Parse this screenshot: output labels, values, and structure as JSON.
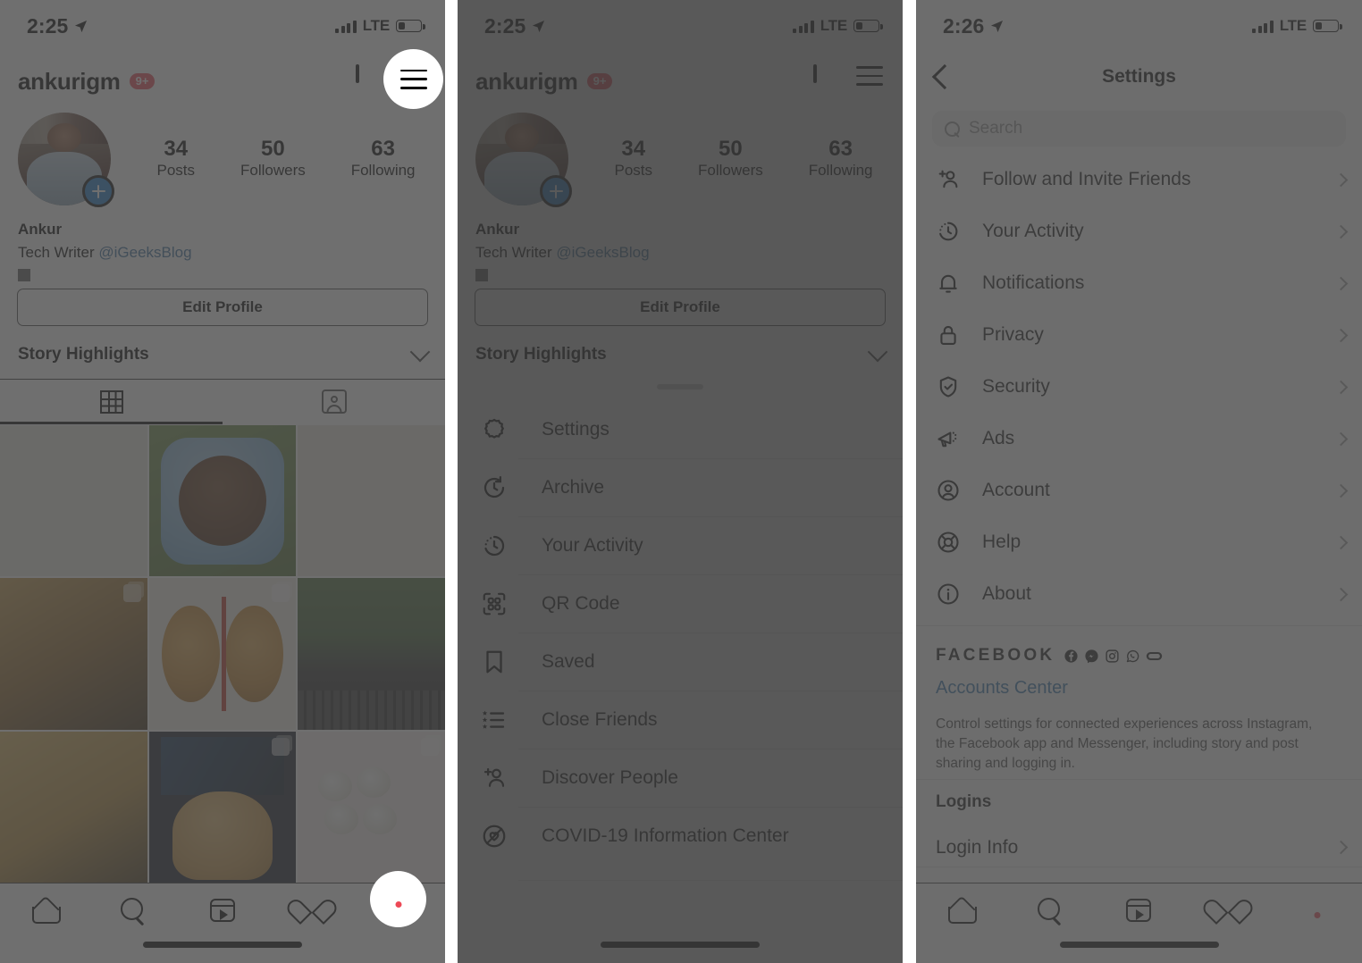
{
  "panel1": {
    "status": {
      "time": "2:25",
      "network": "LTE"
    },
    "profile": {
      "username": "ankurigm",
      "badge": "9+",
      "stats": [
        {
          "number": "34",
          "label": "Posts"
        },
        {
          "number": "50",
          "label": "Followers"
        },
        {
          "number": "63",
          "label": "Following"
        }
      ],
      "display_name": "Ankur",
      "bio_prefix": "Tech Writer ",
      "bio_mention": "@iGeeksBlog",
      "edit_profile_label": "Edit Profile",
      "story_highlights_label": "Story Highlights"
    },
    "icons": {
      "add": "plus-square-icon",
      "menu": "hamburger-menu-icon",
      "grid_tab": "grid-icon",
      "tagged_tab": "tagged-photos-icon",
      "chevron": "chevron-down-icon"
    },
    "tabbar": [
      "home-icon",
      "search-icon",
      "reels-icon",
      "heart-icon",
      "profile-avatar"
    ]
  },
  "panel2": {
    "status": {
      "time": "2:25",
      "network": "LTE"
    },
    "profile": {
      "username": "ankurigm",
      "badge": "9+",
      "stats": [
        {
          "number": "34",
          "label": "Posts"
        },
        {
          "number": "50",
          "label": "Followers"
        },
        {
          "number": "63",
          "label": "Following"
        }
      ],
      "display_name": "Ankur",
      "bio_prefix": "Tech Writer ",
      "bio_mention": "@iGeeksBlog",
      "edit_profile_label": "Edit Profile",
      "story_highlights_label": "Story Highlights"
    },
    "sheet": {
      "items": [
        {
          "label": "Settings",
          "icon": "gear-icon",
          "highlighted": true
        },
        {
          "label": "Archive",
          "icon": "archive-clock-icon",
          "highlighted": false
        },
        {
          "label": "Your Activity",
          "icon": "activity-clock-icon",
          "highlighted": false
        },
        {
          "label": "QR Code",
          "icon": "qr-code-icon",
          "highlighted": false
        },
        {
          "label": "Saved",
          "icon": "bookmark-icon",
          "highlighted": false
        },
        {
          "label": "Close Friends",
          "icon": "close-friends-list-icon",
          "highlighted": false
        },
        {
          "label": "Discover People",
          "icon": "add-person-icon",
          "highlighted": false
        },
        {
          "label": "COVID-19 Information Center",
          "icon": "covid-heart-icon",
          "highlighted": false
        }
      ]
    }
  },
  "panel3": {
    "status": {
      "time": "2:26",
      "network": "LTE"
    },
    "nav": {
      "title": "Settings",
      "back": "back-chevron-icon"
    },
    "search": {
      "placeholder": "Search",
      "icon": "search-icon"
    },
    "settings_items": [
      {
        "label": "Follow and Invite Friends",
        "icon": "add-person-icon",
        "highlighted": false
      },
      {
        "label": "Your Activity",
        "icon": "activity-clock-icon",
        "highlighted": false
      },
      {
        "label": "Notifications",
        "icon": "bell-icon",
        "highlighted": false
      },
      {
        "label": "Privacy",
        "icon": "lock-icon",
        "highlighted": true
      },
      {
        "label": "Security",
        "icon": "shield-check-icon",
        "highlighted": false
      },
      {
        "label": "Ads",
        "icon": "megaphone-icon",
        "highlighted": false
      },
      {
        "label": "Account",
        "icon": "account-circle-icon",
        "highlighted": false
      },
      {
        "label": "Help",
        "icon": "life-ring-icon",
        "highlighted": false
      },
      {
        "label": "About",
        "icon": "info-circle-icon",
        "highlighted": false
      }
    ],
    "facebook": {
      "wordmark": "FACEBOOK",
      "icons": [
        "facebook-icon",
        "messenger-icon",
        "instagram-icon",
        "whatsapp-icon",
        "oculus-icon"
      ],
      "accounts_center_label": "Accounts Center",
      "description": "Control settings for connected experiences across Instagram, the Facebook app and Messenger, including story and post sharing and logging in."
    },
    "logins": {
      "heading": "Logins",
      "rows": [
        {
          "label": "Login Info"
        }
      ]
    }
  },
  "colors": {
    "accent_red": "#ED4956",
    "link_blue": "#2b6ea8",
    "story_blue": "#1877c9",
    "scrim": "#464646",
    "highlight_white": "#ffffff"
  }
}
